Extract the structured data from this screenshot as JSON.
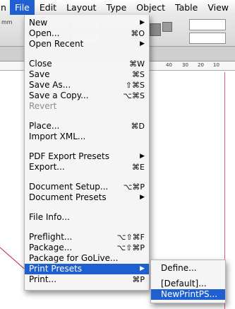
{
  "menubar": {
    "items": [
      {
        "label": "n",
        "active": false
      },
      {
        "label": "File",
        "active": true
      },
      {
        "label": "Edit",
        "active": false
      },
      {
        "label": "Layout",
        "active": false
      },
      {
        "label": "Type",
        "active": false
      },
      {
        "label": "Object",
        "active": false
      },
      {
        "label": "Table",
        "active": false
      },
      {
        "label": "View",
        "active": false
      }
    ]
  },
  "toolbar": {
    "partial_label": "mm"
  },
  "ruler": {
    "ticks": [
      "40",
      "30",
      "20",
      "10"
    ]
  },
  "file_menu": {
    "groups": [
      [
        {
          "label": "New",
          "shortcut": "",
          "submenu": true,
          "disabled": false
        },
        {
          "label": "Open...",
          "shortcut": "⌘O",
          "submenu": false,
          "disabled": false
        },
        {
          "label": "Open Recent",
          "shortcut": "",
          "submenu": true,
          "disabled": false
        }
      ],
      [
        {
          "label": "Close",
          "shortcut": "⌘W",
          "submenu": false,
          "disabled": false
        },
        {
          "label": "Save",
          "shortcut": "⌘S",
          "submenu": false,
          "disabled": false
        },
        {
          "label": "Save As...",
          "shortcut": "⇧⌘S",
          "submenu": false,
          "disabled": false
        },
        {
          "label": "Save a Copy...",
          "shortcut": "⌥⌘S",
          "submenu": false,
          "disabled": false
        },
        {
          "label": "Revert",
          "shortcut": "",
          "submenu": false,
          "disabled": true
        }
      ],
      [
        {
          "label": "Place...",
          "shortcut": "⌘D",
          "submenu": false,
          "disabled": false
        },
        {
          "label": "Import XML...",
          "shortcut": "",
          "submenu": false,
          "disabled": false
        }
      ],
      [
        {
          "label": "PDF Export Presets",
          "shortcut": "",
          "submenu": true,
          "disabled": false
        },
        {
          "label": "Export...",
          "shortcut": "⌘E",
          "submenu": false,
          "disabled": false
        }
      ],
      [
        {
          "label": "Document Setup...",
          "shortcut": "⌥⌘P",
          "submenu": false,
          "disabled": false
        },
        {
          "label": "Document Presets",
          "shortcut": "",
          "submenu": true,
          "disabled": false
        }
      ],
      [
        {
          "label": "File Info...",
          "shortcut": "",
          "submenu": false,
          "disabled": false
        }
      ],
      [
        {
          "label": "Preflight...",
          "shortcut": "⌥⇧⌘F",
          "submenu": false,
          "disabled": false
        },
        {
          "label": "Package...",
          "shortcut": "⌥⇧⌘P",
          "submenu": false,
          "disabled": false
        },
        {
          "label": "Package for GoLive...",
          "shortcut": "",
          "submenu": false,
          "disabled": false
        },
        {
          "label": "Print Presets",
          "shortcut": "",
          "submenu": true,
          "disabled": false,
          "highlight": true
        },
        {
          "label": "Print...",
          "shortcut": "⌘P",
          "submenu": false,
          "disabled": false
        }
      ]
    ]
  },
  "submenu": {
    "items": [
      {
        "label": "Define...",
        "highlight": false
      },
      {
        "label": "[Default]...",
        "highlight": false
      },
      {
        "label": "NewPrintPS...",
        "highlight": true
      }
    ]
  },
  "colors": {
    "highlight": "#1f5fcf",
    "guide": "#e05a7a"
  }
}
